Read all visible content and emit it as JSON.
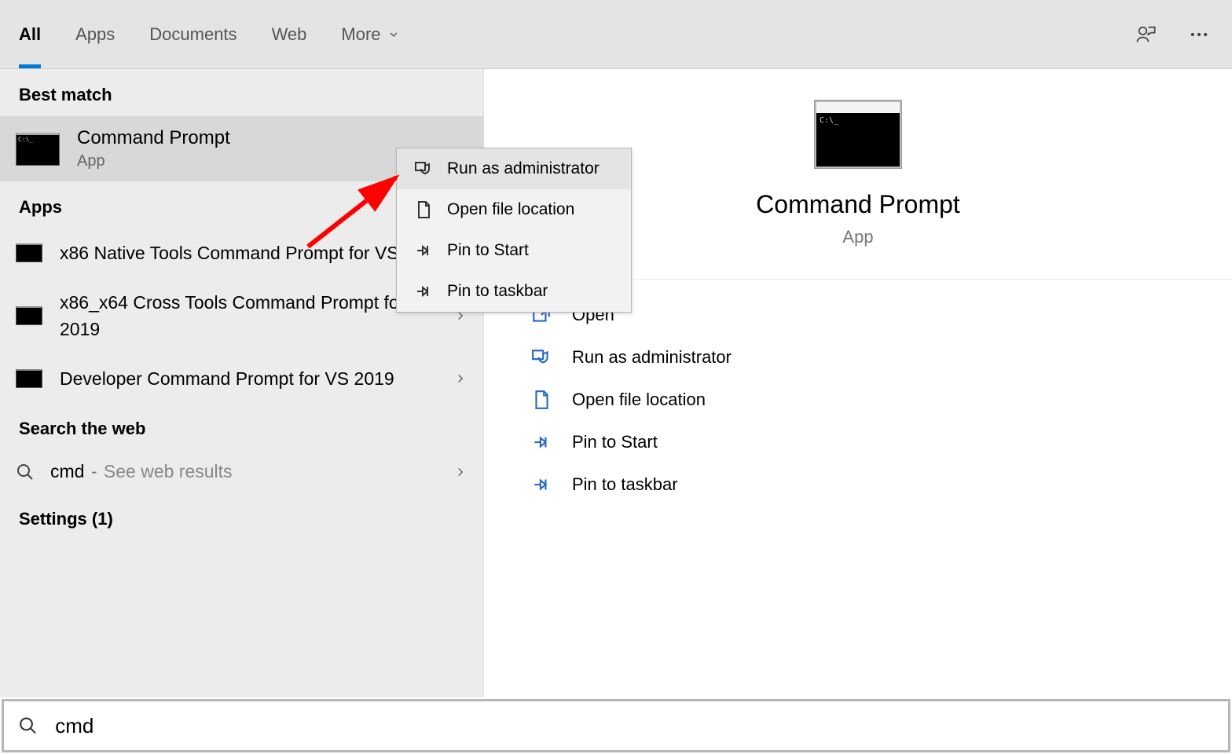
{
  "tabs": {
    "items": [
      "All",
      "Apps",
      "Documents",
      "Web",
      "More"
    ],
    "active_index": 0
  },
  "sidebar": {
    "best_match_header": "Best match",
    "best_match": {
      "title": "Command Prompt",
      "subtitle": "App"
    },
    "apps_header": "Apps",
    "apps": [
      {
        "label": "x86 Native Tools Command Prompt for VS 2019"
      },
      {
        "label": "x86_x64 Cross Tools Command Prompt for VS 2019"
      },
      {
        "label": "Developer Command Prompt for VS 2019"
      }
    ],
    "web_header": "Search the web",
    "web": {
      "query": "cmd",
      "hint": "See web results"
    },
    "settings_header": "Settings (1)"
  },
  "context_menu": {
    "items": [
      {
        "label": "Run as administrator",
        "icon": "admin"
      },
      {
        "label": "Open file location",
        "icon": "file"
      },
      {
        "label": "Pin to Start",
        "icon": "pin"
      },
      {
        "label": "Pin to taskbar",
        "icon": "pin"
      }
    ],
    "highlight_index": 0
  },
  "detail": {
    "title": "Command Prompt",
    "subtitle": "App",
    "actions": [
      {
        "label": "Open",
        "icon": "open"
      },
      {
        "label": "Run as administrator",
        "icon": "admin"
      },
      {
        "label": "Open file location",
        "icon": "file"
      },
      {
        "label": "Pin to Start",
        "icon": "pin"
      },
      {
        "label": "Pin to taskbar",
        "icon": "pin"
      }
    ]
  },
  "search": {
    "value": "cmd"
  }
}
